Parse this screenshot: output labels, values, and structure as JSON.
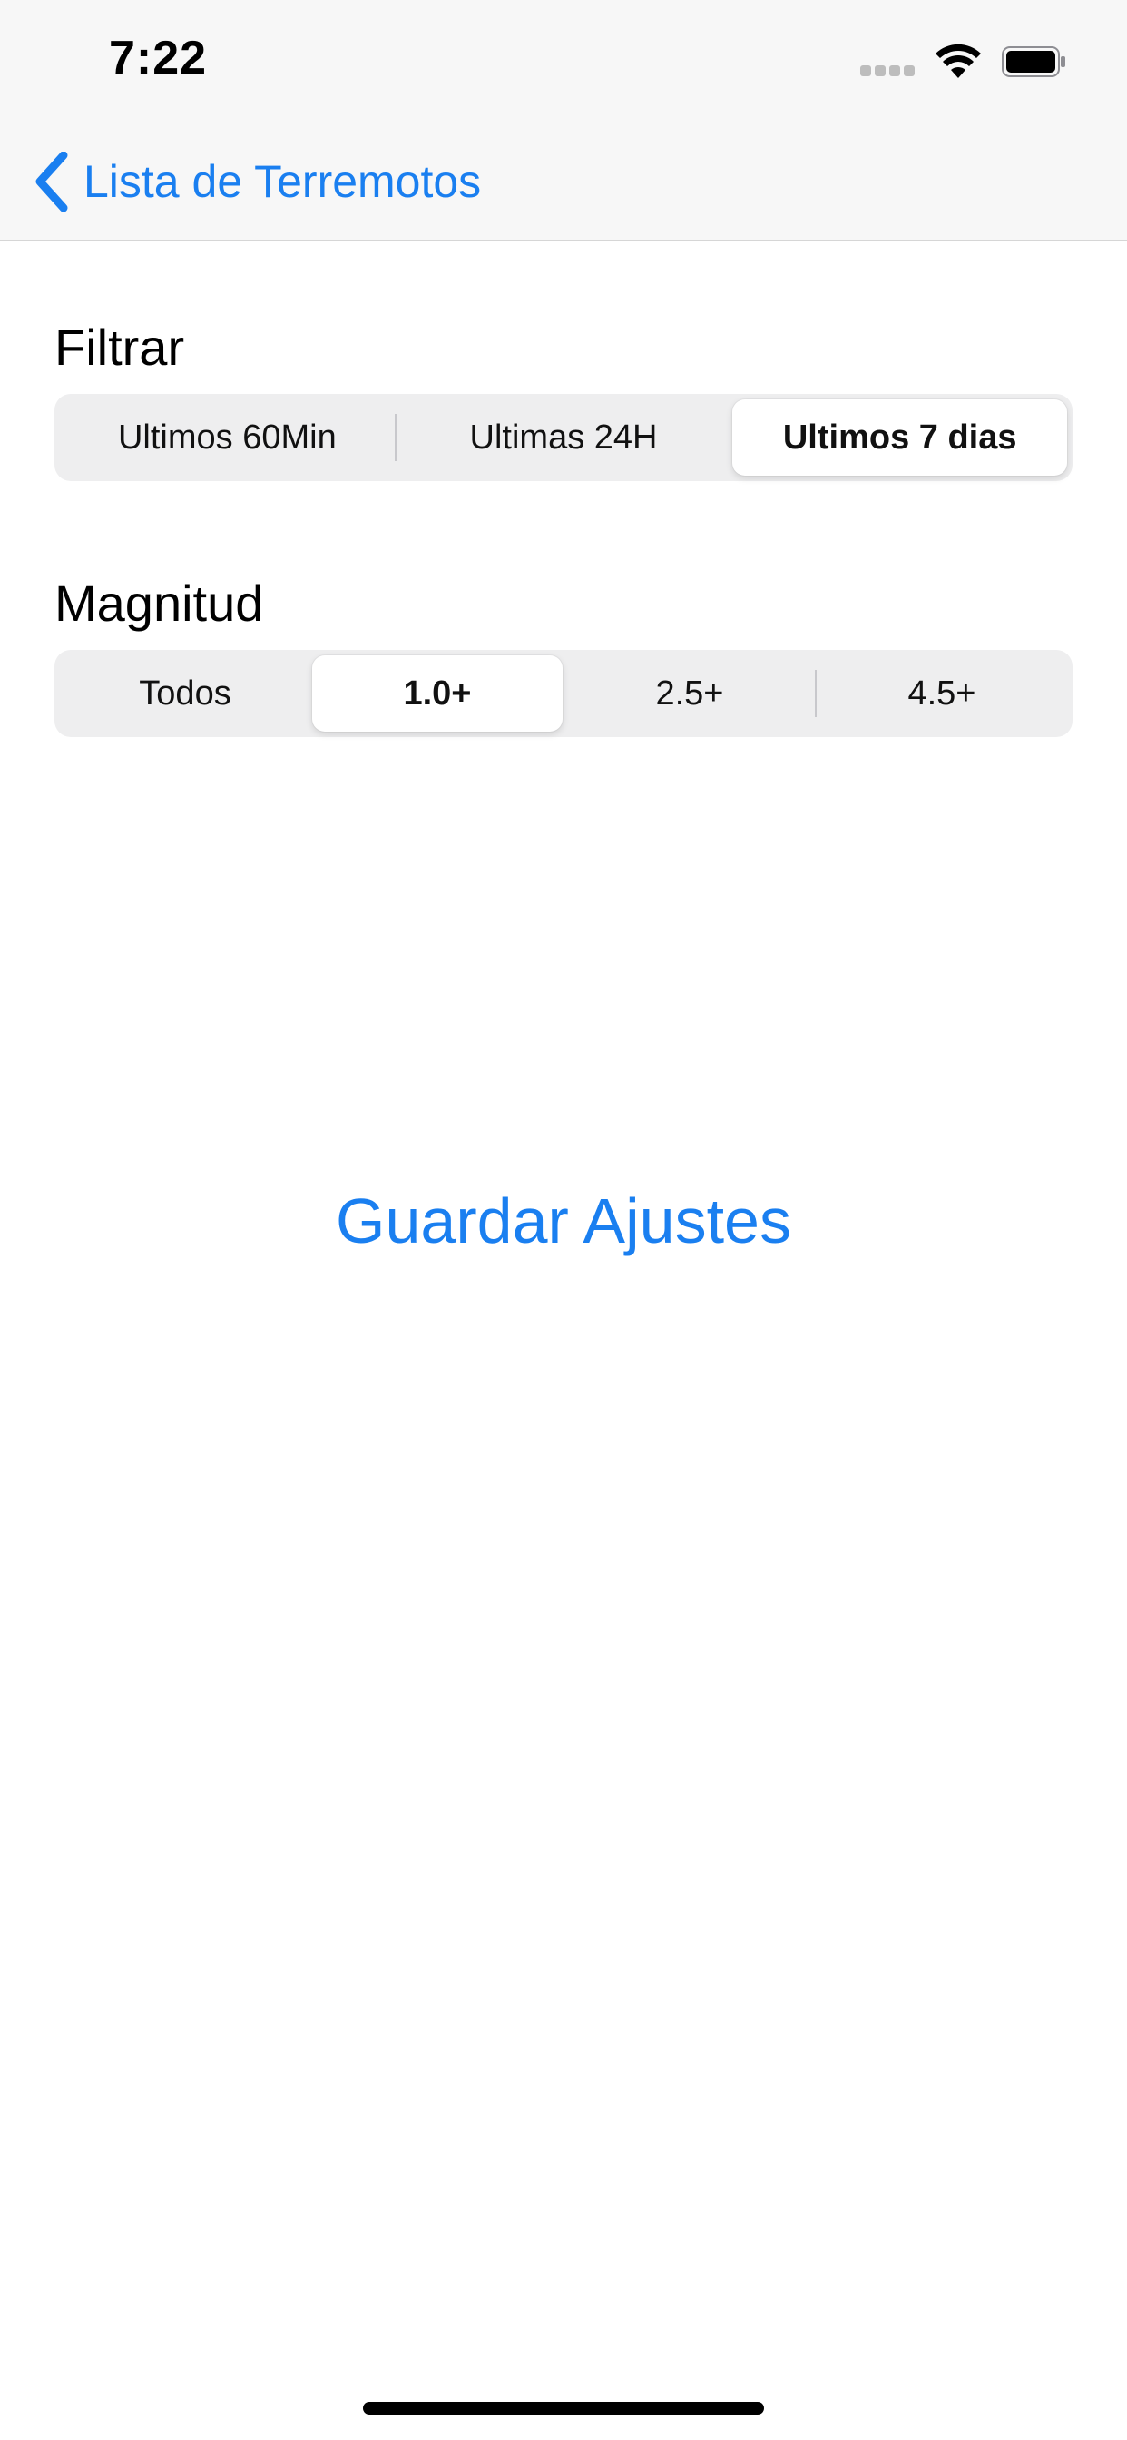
{
  "status_bar": {
    "time": "7:22"
  },
  "nav": {
    "back_label": "Lista de Terremotos",
    "back_icon": "chevron-left-icon"
  },
  "filter": {
    "label": "Filtrar",
    "options": [
      "Ultimos 60Min",
      "Ultimas 24H",
      "Ultimos 7 dias"
    ],
    "selected": "Ultimos 7 dias"
  },
  "magnitude": {
    "label": "Magnitud",
    "options": [
      "Todos",
      "1.0+",
      "2.5+",
      "4.5+"
    ],
    "selected": "1.0+"
  },
  "actions": {
    "save_label": "Guardar Ajustes"
  },
  "colors": {
    "accent": "#1a7ff0",
    "segment_bg": "#eeeeef",
    "nav_bg": "#f7f7f7"
  }
}
